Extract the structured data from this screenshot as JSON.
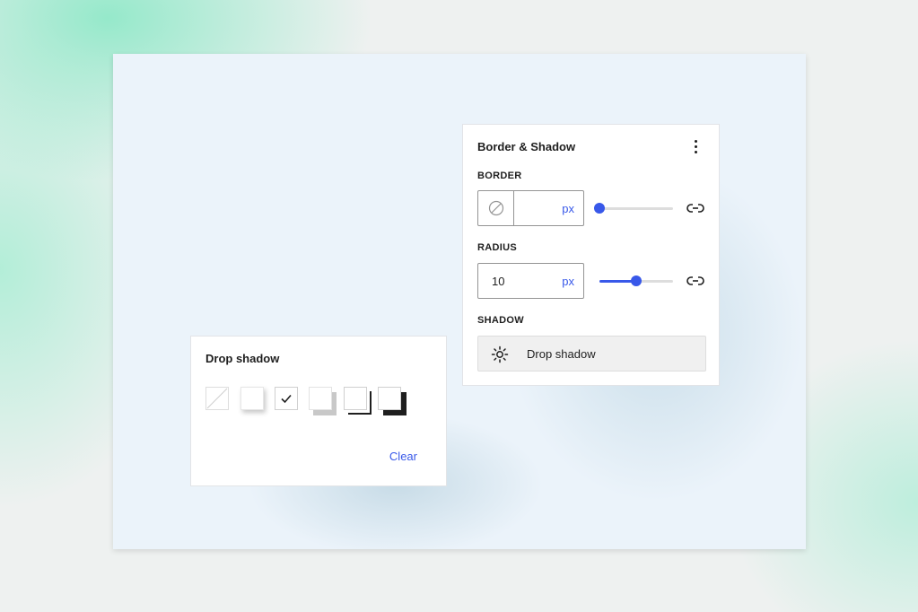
{
  "border_shadow_panel": {
    "title": "Border & Shadow",
    "more_icon": "vertical-ellipsis-icon",
    "border": {
      "label": "BORDER",
      "value": "",
      "unit": "px",
      "swatch_icon": "no-color-icon",
      "slider_fraction": 0.0,
      "link_icon": "link-icon"
    },
    "radius": {
      "label": "RADIUS",
      "value": "10",
      "unit": "px",
      "slider_fraction": 0.5,
      "link_icon": "link-icon"
    },
    "shadow": {
      "label": "SHADOW",
      "button_label": "Drop shadow",
      "button_icon": "sun-icon"
    }
  },
  "drop_shadow_popover": {
    "title": "Drop shadow",
    "options": [
      {
        "name": "none",
        "selected": false
      },
      {
        "name": "soft",
        "selected": false
      },
      {
        "name": "natural",
        "selected": true
      },
      {
        "name": "deep",
        "selected": false
      },
      {
        "name": "sharp",
        "selected": false
      },
      {
        "name": "outlined",
        "selected": false
      }
    ],
    "clear_label": "Clear"
  },
  "colors": {
    "accent": "#3858e9",
    "canvas": "#ebf3fa",
    "text": "#1e1e1e"
  }
}
